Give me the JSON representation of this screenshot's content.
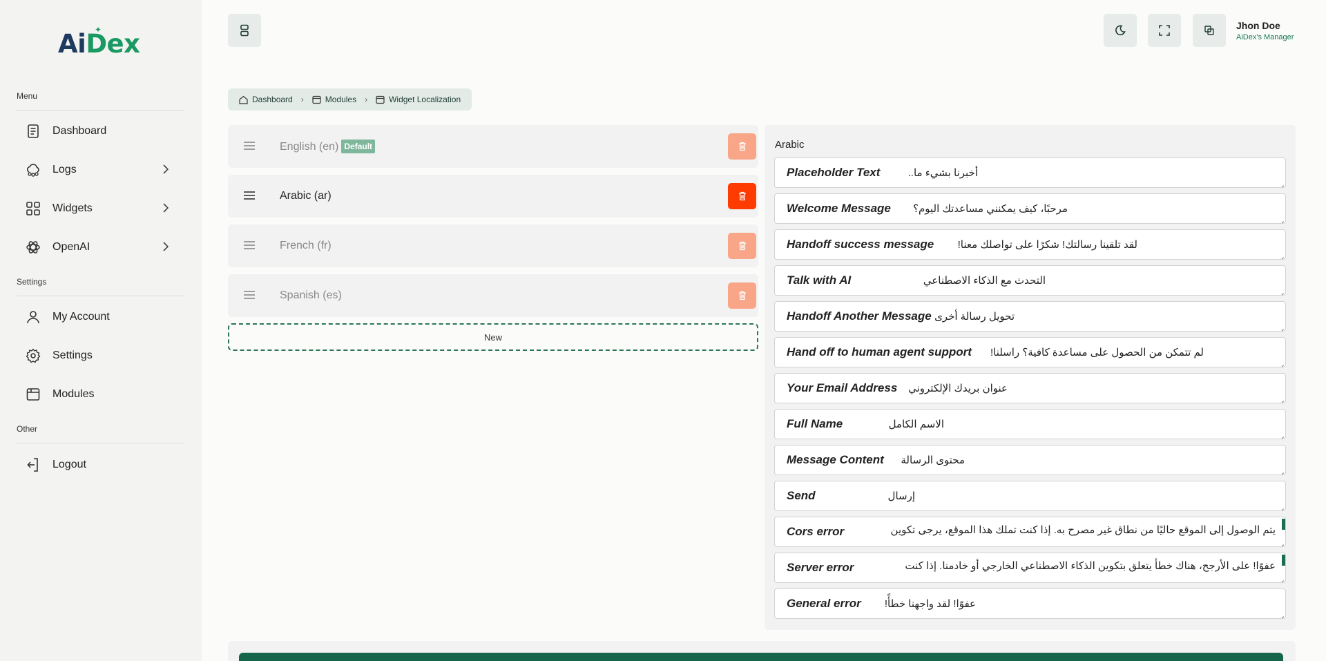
{
  "brand": {
    "logo_ai": "Ai",
    "logo_d": "D",
    "logo_ex": "ex"
  },
  "sidebar": {
    "menu_label": "Menu",
    "settings_label": "Settings",
    "other_label": "Other",
    "items": [
      {
        "label": "Dashboard",
        "icon": "document-icon"
      },
      {
        "label": "Logs",
        "icon": "cloud-nodes-icon"
      },
      {
        "label": "Widgets",
        "icon": "grid-icon"
      },
      {
        "label": "OpenAI",
        "icon": "openai-icon"
      },
      {
        "label": "My Account",
        "icon": "user-icon"
      },
      {
        "label": "Settings",
        "icon": "gear-icon"
      },
      {
        "label": "Modules",
        "icon": "box-icon"
      },
      {
        "label": "Logout",
        "icon": "logout-icon"
      }
    ]
  },
  "header": {
    "user_name": "Jhon Doe",
    "user_role": "AiDex's Manager"
  },
  "breadcrumb": [
    "Dashboard",
    "Modules",
    "Widget Localization"
  ],
  "languages": [
    {
      "name": "English (en)",
      "badge": "Default",
      "active": false
    },
    {
      "name": "Arabic (ar)",
      "badge": "",
      "active": true
    },
    {
      "name": "French (fr)",
      "badge": "",
      "active": false
    },
    {
      "name": "Spanish (es)",
      "badge": "",
      "active": false
    }
  ],
  "new_button": "New",
  "panel": {
    "title": "Arabic",
    "fields": [
      {
        "label": "Placeholder Text",
        "value": "أخبرنا بشيء ما.."
      },
      {
        "label": "Welcome Message",
        "value": "مرحبًا، كيف يمكنني مساعدتك اليوم؟"
      },
      {
        "label": "Handoff success message",
        "value": "لقد تلقينا رسالتك! شكرًا على تواصلك معنا!"
      },
      {
        "label": "Talk with AI",
        "value": "التحدث مع الذكاء الاصطناعي"
      },
      {
        "label": "Handoff Another Message",
        "value": "تحويل رسالة أخرى"
      },
      {
        "label": "Hand off to human agent support",
        "value": "لم تتمكن من الحصول على مساعدة كافية؟ راسلنا!"
      },
      {
        "label": "Your Email Address",
        "value": "عنوان بريدك الإلكتروني"
      },
      {
        "label": "Full Name",
        "value": "الاسم الكامل"
      },
      {
        "label": "Message Content",
        "value": "محتوى الرسالة"
      },
      {
        "label": "Send",
        "value": "إرسال"
      },
      {
        "label": "Cors error",
        "value": "يتم الوصول إلى الموقع حاليًا من نطاق غير مصرح به. إذا كنت تملك هذا الموقع، يرجى تكوين"
      },
      {
        "label": "Server error",
        "value": "عفوًا! على الأرجح، هناك خطأ يتعلق بتكوين الذكاء الاصطناعي الخارجي أو خادمنا. إذا كنت"
      },
      {
        "label": "General error",
        "value": "عفوًا! لقد واجهنا خطأً!"
      }
    ]
  }
}
